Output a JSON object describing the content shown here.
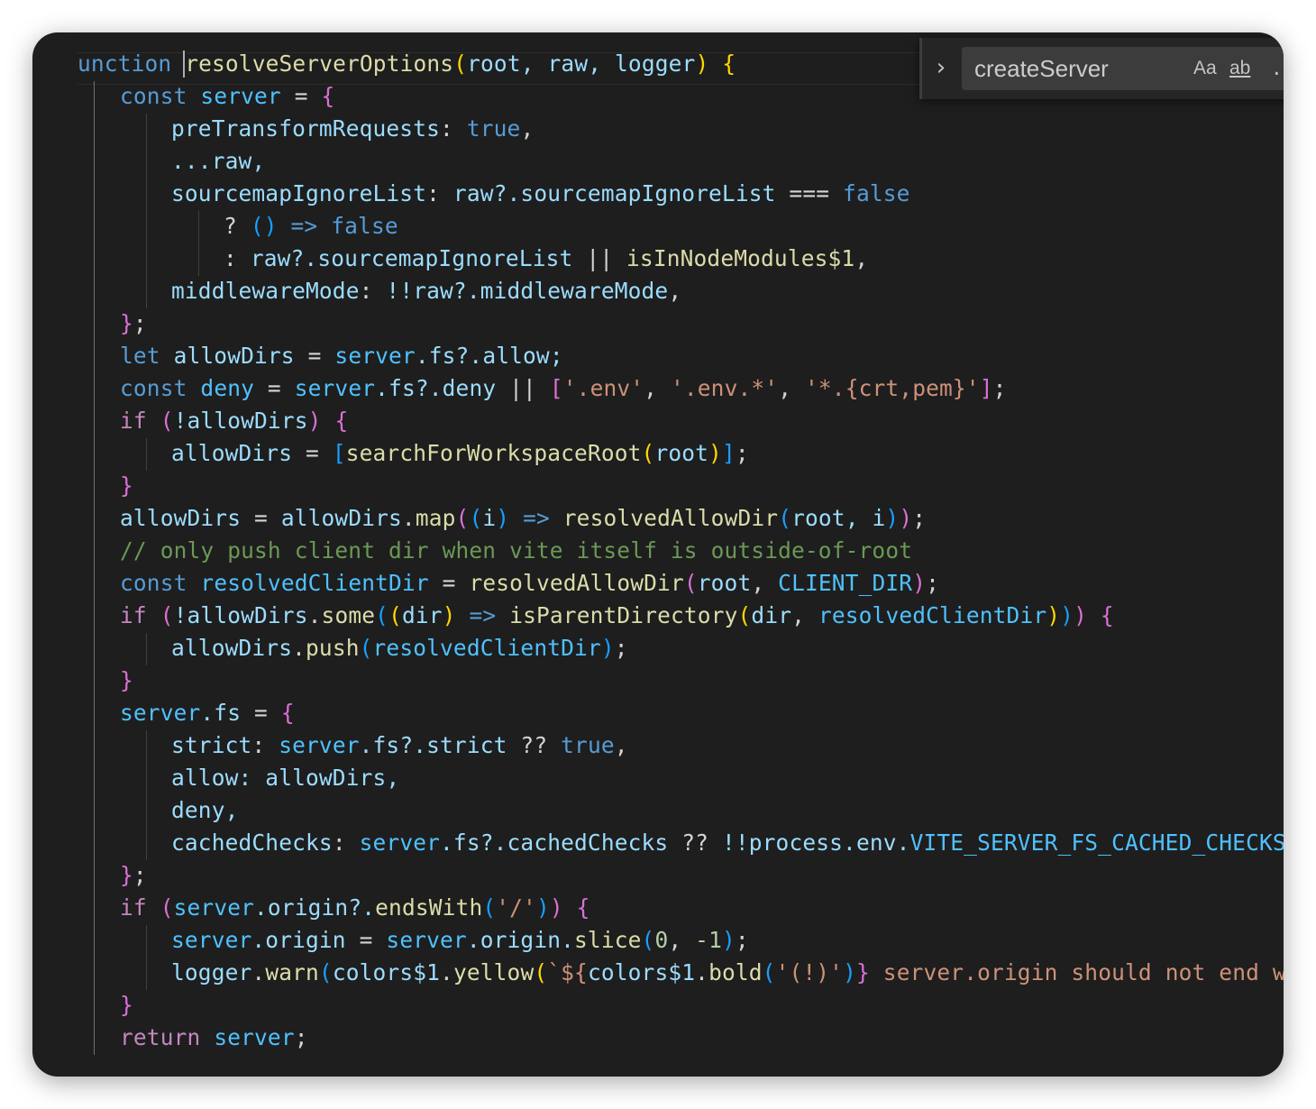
{
  "find": {
    "query": "createServer",
    "toggle_glyph": "›",
    "match_case_label": "Aa",
    "whole_word_label": "ab",
    "regex_label": ".*"
  },
  "code": {
    "line1": {
      "kw": "unction ",
      "name": "resolveServerOptions",
      "params": "root, raw, logger"
    },
    "line2_kw": "const",
    "line2_var": "server",
    "line3_key": "preTransformRequests",
    "line3_val": "true",
    "line4": "...raw,",
    "line5_key": "sourcemapIgnoreList",
    "line5_expr": "raw?.sourcemapIgnoreList",
    "line5_val": "false",
    "line6_val": "false",
    "line7_expr": "raw?.sourcemapIgnoreList",
    "line7_fn": "isInNodeModules$1",
    "line8_key": "middlewareMode",
    "line8_expr": "!!raw?.middlewareMode",
    "line10_kw": "let",
    "line10_var": "allowDirs",
    "line10_obj": "server",
    "line10_rest": ".fs?.allow;",
    "line11_kw": "const",
    "line11_var": "deny",
    "line11_obj": "server",
    "line11_rest": ".fs?.deny",
    "line11_s1": "'.env'",
    "line11_s2": "'.env.*'",
    "line11_s3": "'*.{crt,pem}'",
    "line12_kw": "if",
    "line12_expr": "!allowDirs",
    "line13_var": "allowDirs",
    "line13_fn": "searchForWorkspaceRoot",
    "line13_arg": "root",
    "line15_var": "allowDirs",
    "line15_obj": "allowDirs",
    "line15_fn": "map",
    "line15_p": "i",
    "line15_call": "resolvedAllowDir",
    "line15_args": "root, i",
    "line16_comment": "// only push client dir when vite itself is outside-of-root",
    "line17_kw": "const",
    "line17_var": "resolvedClientDir",
    "line17_fn": "resolvedAllowDir",
    "line17_a1": "root",
    "line17_a2": "CLIENT_DIR",
    "line18_kw": "if",
    "line18_obj": "!allowDirs",
    "line18_fn": "some",
    "line18_p": "dir",
    "line18_call": "isParentDirectory",
    "line18_a1": "dir",
    "line18_a2": "resolvedClientDir",
    "line19_obj": "allowDirs",
    "line19_fn": "push",
    "line19_arg": "resolvedClientDir",
    "line21_obj": "server",
    "line21_rest": ".fs",
    "line22_key": "strict",
    "line22_obj": "server",
    "line22_rest": ".fs?.strict",
    "line22_val": "true",
    "line23": "allow: allowDirs,",
    "line24": "deny,",
    "line25_key": "cachedChecks",
    "line25_obj": "server",
    "line25_rest": ".fs?.cachedChecks",
    "line25_b": "!!process.env.",
    "line25_env": "VITE_SERVER_FS_CACHED_CHECKS",
    "line27_kw": "if",
    "line27_obj": "server",
    "line27_rest": ".origin?.",
    "line27_fn": "endsWith",
    "line27_str": "'/'",
    "line28_obj": "server",
    "line28_rest": ".origin",
    "line28_obj2": "server",
    "line28_rest2": ".origin.",
    "line28_fn": "slice",
    "line28_n1": "0",
    "line28_n2": "-1",
    "line29_obj": "logger",
    "line29_fn": "warn",
    "line29_c1": "colors$1",
    "line29_fn2": "yellow",
    "line29_tpl": "`${",
    "line29_c2": "colors$1",
    "line29_fn3": "bold",
    "line29_s": "'(!)'",
    "line29_tail": " server.origin should not end with",
    "line31_kw": "return",
    "line31_var": "server"
  }
}
